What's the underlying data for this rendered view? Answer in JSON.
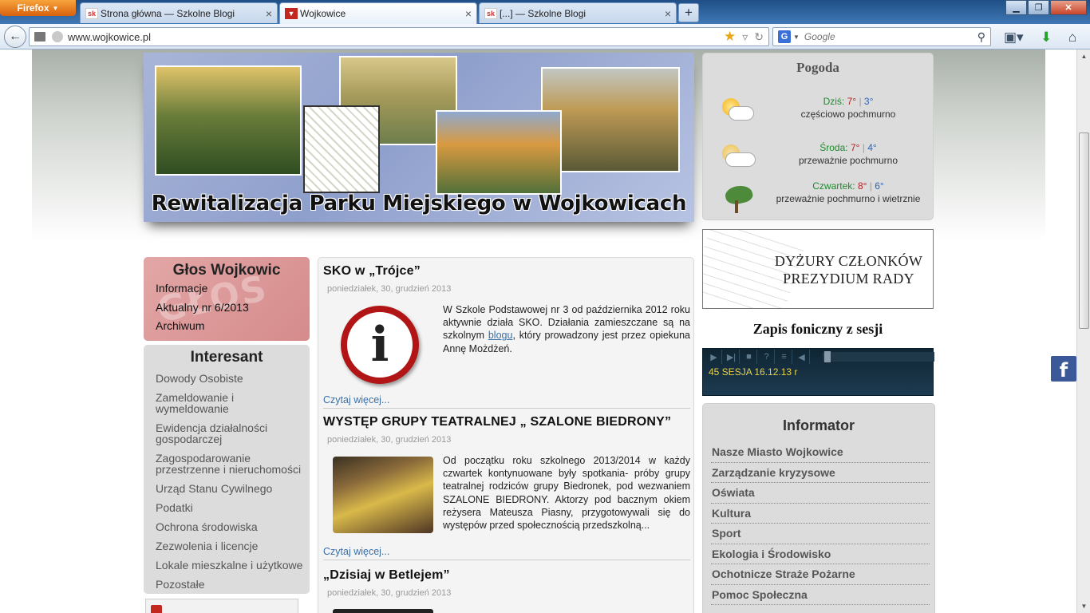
{
  "browser": {
    "firefox_label": "Firefox",
    "tabs": [
      {
        "favicon": "sk",
        "title": "Strona główna — Szkolne Blogi"
      },
      {
        "favicon": "crest",
        "title": "Wojkowice"
      },
      {
        "favicon": "sk",
        "title": "[...] — Szkolne Blogi"
      }
    ],
    "active_tab": 1,
    "url": "www.wojkowice.pl",
    "search_placeholder": "Google",
    "search_engine": "G"
  },
  "banner": {
    "title": "Rewitalizacja Parku Miejskiego w Wojkowicach"
  },
  "weather": {
    "title": "Pogoda",
    "days": [
      {
        "day": "Dziś:",
        "hi": "7°",
        "lo": "3°",
        "desc": "częściowo pochmurno",
        "icon": "partly-cloudy-icon"
      },
      {
        "day": "Środa:",
        "hi": "7°",
        "lo": "4°",
        "desc": "przeważnie pochmurno",
        "icon": "mostly-cloudy-icon"
      },
      {
        "day": "Czwartek:",
        "hi": "8°",
        "lo": "6°",
        "desc": "przeważnie pochmurno i wietrznie",
        "icon": "windy-icon"
      }
    ]
  },
  "duty_banner": {
    "text": "DYŻURY CZŁONKÓW PREZYDIUM RADY"
  },
  "audio": {
    "title": "Zapis foniczny z sesji",
    "track": "45 SESJA 16.12.13 r"
  },
  "informator": {
    "title": "Informator",
    "items": [
      "Nasze Miasto Wojkowice",
      "Zarządzanie kryzysowe",
      "Oświata",
      "Kultura",
      "Sport",
      "Ekologia i Środowisko",
      "Ochotnicze Straże Pożarne",
      "Pomoc Społeczna"
    ]
  },
  "glos": {
    "title": "Głos Wojkowic",
    "watermark": "GŁOS",
    "links": [
      "Informacje",
      "Aktualny nr 6/2013",
      "Archiwum"
    ]
  },
  "interesant": {
    "title": "Interesant",
    "links": [
      "Dowody Osobiste",
      "Zameldowanie i wymeldowanie",
      "Ewidencja działalności gospodarczej",
      "Zagospodarowanie przestrzenne i nieruchomości",
      "Urząd Stanu Cywilnego",
      "Podatki",
      "Ochrona środowiska",
      "Zezwolenia i licencje",
      "Lokale mieszkalne i użytkowe",
      "Pozostałe"
    ]
  },
  "articles": [
    {
      "title": "SKO w „Trójce”",
      "date": "poniedziałek, 30, grudzień 2013",
      "text_before": "W Szkole Podstawowej nr 3 od października 2012 roku aktywnie działa SKO. Działania zamieszczane są na szkolnym ",
      "link": "blogu",
      "text_after": ", który prowadzony jest przez opiekuna Annę Możdżeń.",
      "more": "Czytaj więcej..."
    },
    {
      "title": "WYSTĘP GRUPY TEATRALNEJ „ SZALONE BIEDRONY”",
      "date": "poniedziałek, 30, grudzień 2013",
      "text": "Od początku roku szkolnego 2013/2014 w każdy czwartek kontynuowane były spotkania- próby grupy teatralnej rodziców grupy Biedronek, pod wezwaniem SZALONE BIEDRONY. Aktorzy pod bacznym okiem reżysera Mateusza Piasny, przygotowywali się do występów przed społecznością przedszkolną...",
      "more": "Czytaj więcej..."
    },
    {
      "title": "„Dzisiaj w Betlejem”",
      "date": "poniedziałek, 30, grudzień 2013"
    }
  ],
  "facebook": {
    "label": "f"
  }
}
